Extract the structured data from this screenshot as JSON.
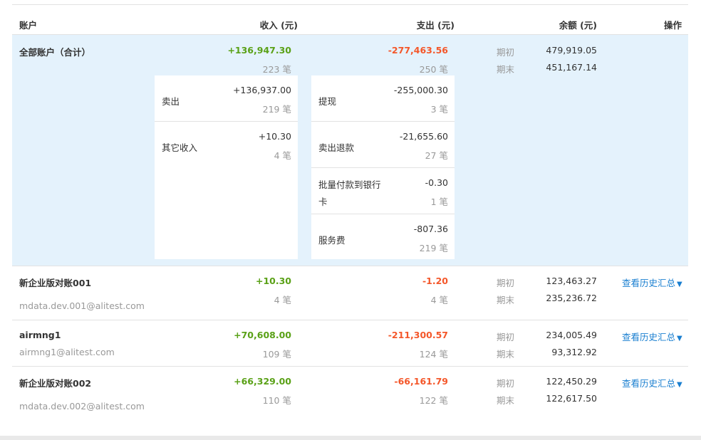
{
  "header": {
    "account": "账户",
    "income": "收入 (元)",
    "expense": "支出 (元)",
    "balance": "余额 (元)",
    "action": "操作"
  },
  "total": {
    "name": "全部账户（合计）",
    "income": "+136,947.30",
    "income_count": "223 笔",
    "expense": "-277,463.56",
    "expense_count": "250 笔",
    "open_label": "期初",
    "open_value": "479,919.05",
    "close_label": "期末",
    "close_value": "451,167.14",
    "income_items": [
      {
        "label": "卖出",
        "amount": "+136,937.00",
        "count": "219 笔"
      },
      {
        "label": "其它收入",
        "amount": "+10.30",
        "count": "4 笔"
      }
    ],
    "expense_items": [
      {
        "label": "提现",
        "amount": "-255,000.30",
        "count": "3 笔"
      },
      {
        "label": "卖出退款",
        "amount": "-21,655.60",
        "count": "27 笔"
      },
      {
        "label_line1": "批量付款到银行",
        "label_line2": "卡",
        "amount": "-0.30",
        "count": "1 笔"
      },
      {
        "label": "服务费",
        "amount": "-807.36",
        "count": "219 笔"
      }
    ]
  },
  "accounts": [
    {
      "name": "新企业版对账001",
      "email": "mdata.dev.001@alitest.com",
      "income": "+10.30",
      "income_count": "4 笔",
      "expense": "-1.20",
      "expense_count": "4 笔",
      "open_label": "期初",
      "open_value": "123,463.27",
      "close_label": "期末",
      "close_value": "235,236.72",
      "action": "查看历史汇总"
    },
    {
      "name": "airmng1",
      "email": "airmng1@alitest.com",
      "income": "+70,608.00",
      "income_count": "109 笔",
      "expense": "-211,300.57",
      "expense_count": "124 笔",
      "open_label": "期初",
      "open_value": "234,005.49",
      "close_label": "期末",
      "close_value": "93,312.92",
      "action": "查看历史汇总"
    },
    {
      "name": "新企业版对账002",
      "email": "mdata.dev.002@alitest.com",
      "income": "+66,329.00",
      "income_count": "110 笔",
      "expense": "-66,161.79",
      "expense_count": "122 笔",
      "open_label": "期初",
      "open_value": "122,450.29",
      "close_label": "期末",
      "close_value": "122,617.50",
      "action": "查看历史汇总"
    }
  ],
  "icons": {
    "dropdown": "triangle-down-icon"
  },
  "colors": {
    "income": "#5aa117",
    "expense": "#f4572a",
    "link": "#1a7fd0",
    "highlight": "#e4f2fc"
  }
}
